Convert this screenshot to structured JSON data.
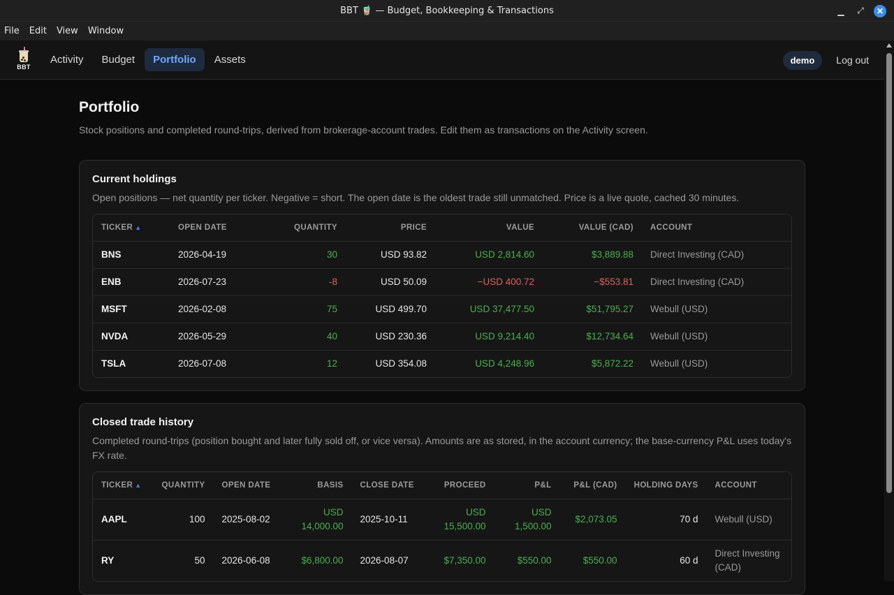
{
  "window": {
    "title": "BBT 🧋 — Budget, Bookkeeping & Transactions"
  },
  "menu": [
    "File",
    "Edit",
    "View",
    "Window"
  ],
  "nav": {
    "logo_text": "BBT",
    "tabs": [
      "Activity",
      "Budget",
      "Portfolio",
      "Assets"
    ],
    "active_tab": "Portfolio",
    "user": "demo",
    "logout": "Log out"
  },
  "page": {
    "title": "Portfolio",
    "subtitle": "Stock positions and completed round-trips, derived from brokerage-account trades. Edit them as transactions on the Activity screen."
  },
  "holdings": {
    "title": "Current holdings",
    "description": "Open positions — net quantity per ticker. Negative = short. The open date is the oldest trade still unmatched. Price is a live quote, cached 30 minutes.",
    "columns": [
      "TICKER",
      "OPEN DATE",
      "QUANTITY",
      "PRICE",
      "VALUE",
      "VALUE (CAD)",
      "ACCOUNT"
    ],
    "rows": [
      {
        "ticker": "BNS",
        "open_date": "2026-04-19",
        "quantity": "30",
        "price": "USD 93.82",
        "value": "USD 2,814.60",
        "value_cad": "$3,889.88",
        "account": "Direct Investing (CAD)",
        "sign": "pos"
      },
      {
        "ticker": "ENB",
        "open_date": "2026-07-23",
        "quantity": "-8",
        "price": "USD 50.09",
        "value": "−USD 400.72",
        "value_cad": "−$553.81",
        "account": "Direct Investing (CAD)",
        "sign": "neg"
      },
      {
        "ticker": "MSFT",
        "open_date": "2026-02-08",
        "quantity": "75",
        "price": "USD 499.70",
        "value": "USD 37,477.50",
        "value_cad": "$51,795.27",
        "account": "Webull (USD)",
        "sign": "pos"
      },
      {
        "ticker": "NVDA",
        "open_date": "2026-05-29",
        "quantity": "40",
        "price": "USD 230.36",
        "value": "USD 9,214.40",
        "value_cad": "$12,734.64",
        "account": "Webull (USD)",
        "sign": "pos"
      },
      {
        "ticker": "TSLA",
        "open_date": "2026-07-08",
        "quantity": "12",
        "price": "USD 354.08",
        "value": "USD 4,248.96",
        "value_cad": "$5,872.22",
        "account": "Webull (USD)",
        "sign": "pos"
      }
    ]
  },
  "closed": {
    "title": "Closed trade history",
    "description": "Completed round-trips (position bought and later fully sold off, or vice versa). Amounts are as stored, in the account currency; the base-currency P&L uses today's FX rate.",
    "columns": [
      "TICKER",
      "QUANTITY",
      "OPEN DATE",
      "BASIS",
      "CLOSE DATE",
      "PROCEED",
      "P&L",
      "P&L (CAD)",
      "HOLDING DAYS",
      "ACCOUNT"
    ],
    "rows": [
      {
        "ticker": "AAPL",
        "quantity": "100",
        "open_date": "2025-08-02",
        "basis": "USD 14,000.00",
        "close_date": "2025-10-11",
        "proceed": "USD 15,500.00",
        "pnl": "USD 1,500.00",
        "pnl_cad": "$2,073.05",
        "holding_days": "70 d",
        "account": "Webull (USD)"
      },
      {
        "ticker": "RY",
        "quantity": "50",
        "open_date": "2026-06-08",
        "basis": "$6,800.00",
        "close_date": "2026-08-07",
        "proceed": "$7,350.00",
        "pnl": "$550.00",
        "pnl_cad": "$550.00",
        "holding_days": "60 d",
        "account": "Direct Investing (CAD)"
      }
    ]
  },
  "colors": {
    "positive": "#4caf50",
    "negative": "#e0605a",
    "accent": "#6fa7ff"
  }
}
